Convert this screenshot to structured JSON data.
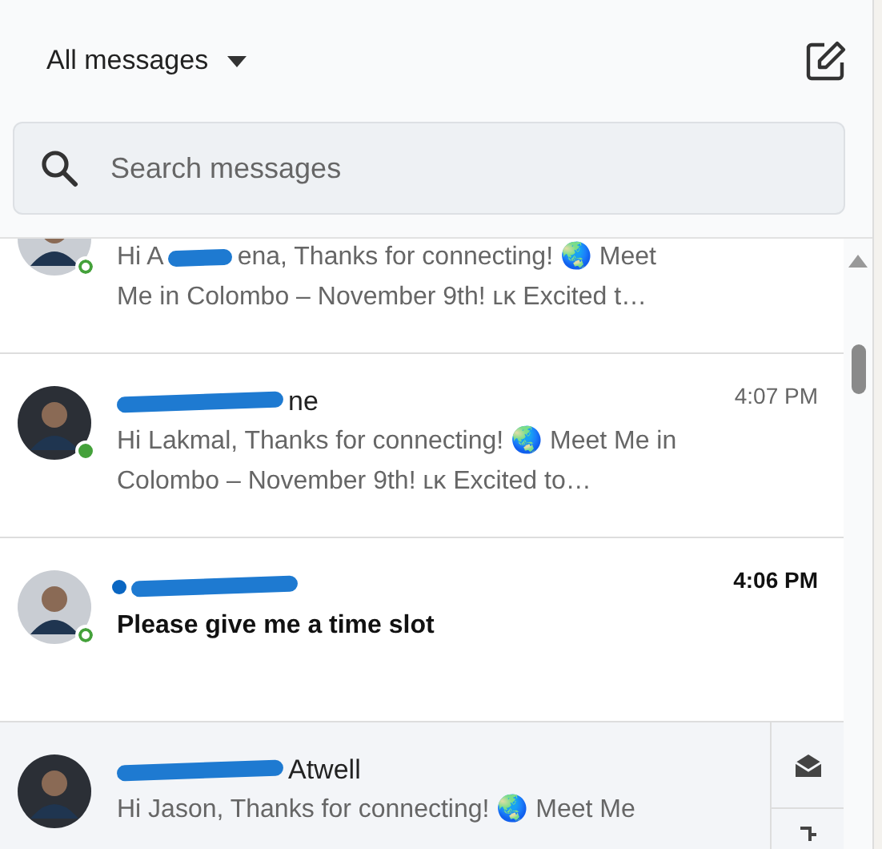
{
  "header": {
    "title": "All messages"
  },
  "search": {
    "placeholder": "Search messages"
  },
  "conversations": [
    {
      "unread": false,
      "online": true,
      "idle": true,
      "hovered": false,
      "preview": [
        {
          "kind": "text",
          "text": "Hi A"
        },
        {
          "kind": "redaction"
        },
        {
          "kind": "text",
          "text": "ena, Thanks for connecting! 🌏 Meet"
        },
        {
          "kind": "break"
        },
        {
          "kind": "text",
          "text": "Me in Colombo – November 9th! ʟᴋ Excited t…"
        }
      ]
    },
    {
      "name": [
        {
          "kind": "redaction"
        },
        {
          "kind": "text",
          "text": "ne"
        }
      ],
      "time": "4:07 PM",
      "unread": false,
      "online": true,
      "idle": false,
      "hovered": false,
      "preview": [
        {
          "kind": "text",
          "text": "Hi Lakmal, Thanks for connecting! 🌏 Meet Me in Colombo – November 9th! ʟᴋ Excited to…"
        }
      ]
    },
    {
      "name": [
        {
          "kind": "redaction"
        }
      ],
      "time": "4:06 PM",
      "unread": true,
      "online": true,
      "idle": true,
      "hovered": false,
      "preview": [
        {
          "kind": "text",
          "text": "Please give me a time slot"
        }
      ]
    },
    {
      "name": [
        {
          "kind": "redaction"
        },
        {
          "kind": "text",
          "text": "Atwell"
        }
      ],
      "unread": false,
      "online": false,
      "hovered": true,
      "preview": [
        {
          "kind": "text",
          "text": "Hi Jason, Thanks for connecting! 🌏 Meet Me"
        }
      ]
    }
  ]
}
